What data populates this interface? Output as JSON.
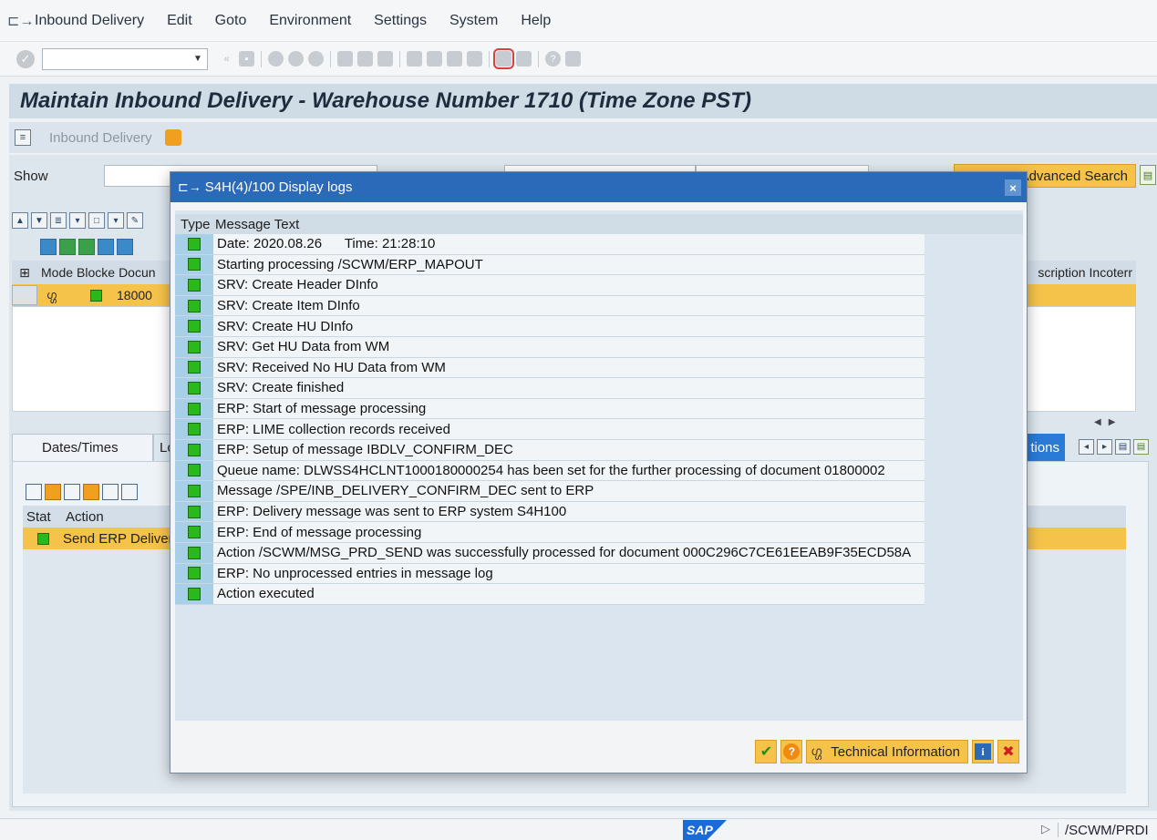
{
  "menubar": {
    "items": [
      "Inbound Delivery",
      "Edit",
      "Goto",
      "Environment",
      "Settings",
      "System",
      "Help"
    ]
  },
  "toolbar": {
    "command_field_value": ""
  },
  "title": "Maintain Inbound Delivery - Warehouse Number 1710 (Time Zone PST)",
  "app_toolbar": {
    "label": "Inbound Delivery"
  },
  "main": {
    "show_label": "Show",
    "advanced_search_label": "Advanced Search",
    "grid_header": [
      "Mode",
      "Blocke",
      "Docun",
      "scription",
      "Incoterr"
    ],
    "grid_row": {
      "document": "18000"
    },
    "tabs": [
      "Dates/Times",
      "Lo"
    ],
    "tab_right_label": "tions",
    "actions_header": [
      "Stat",
      "Action"
    ],
    "actions_row": "Send ERP Deliver"
  },
  "status_bar": {
    "logo": "SAP",
    "transaction": "/SCWM/PRDI"
  },
  "dialog": {
    "title": "S4H(4)/100 Display logs",
    "columns": [
      "Type",
      "Message Text"
    ],
    "messages": [
      "Date: 2020.08.26      Time: 21:28:10",
      "Starting processing /SCWM/ERP_MAPOUT",
      "SRV: Create Header DInfo",
      "SRV: Create Item DInfo",
      "SRV: Create HU DInfo",
      "SRV: Get HU Data from WM",
      "SRV: Received No HU Data from WM",
      "SRV: Create finished",
      "ERP: Start of message processing",
      "ERP: LIME collection records received",
      "ERP: Setup of message IBDLV_CONFIRM_DEC",
      "Queue name: DLWSS4HCLNT1000180000254 has been set for the further processing of document 01800002",
      "Message /SPE/INB_DELIVERY_CONFIRM_DEC sent to ERP",
      "ERP: Delivery message was sent to ERP system S4H100",
      "ERP: End of message processing",
      "Action /SCWM/MSG_PRD_SEND was successfully processed for document 000C296C7CE61EEAB9F35ECD58A",
      "ERP: No unprocessed entries in message log",
      "Action executed"
    ],
    "footer": {
      "technical_info_label": "Technical Information"
    },
    "status_color": "#2bb81c"
  }
}
